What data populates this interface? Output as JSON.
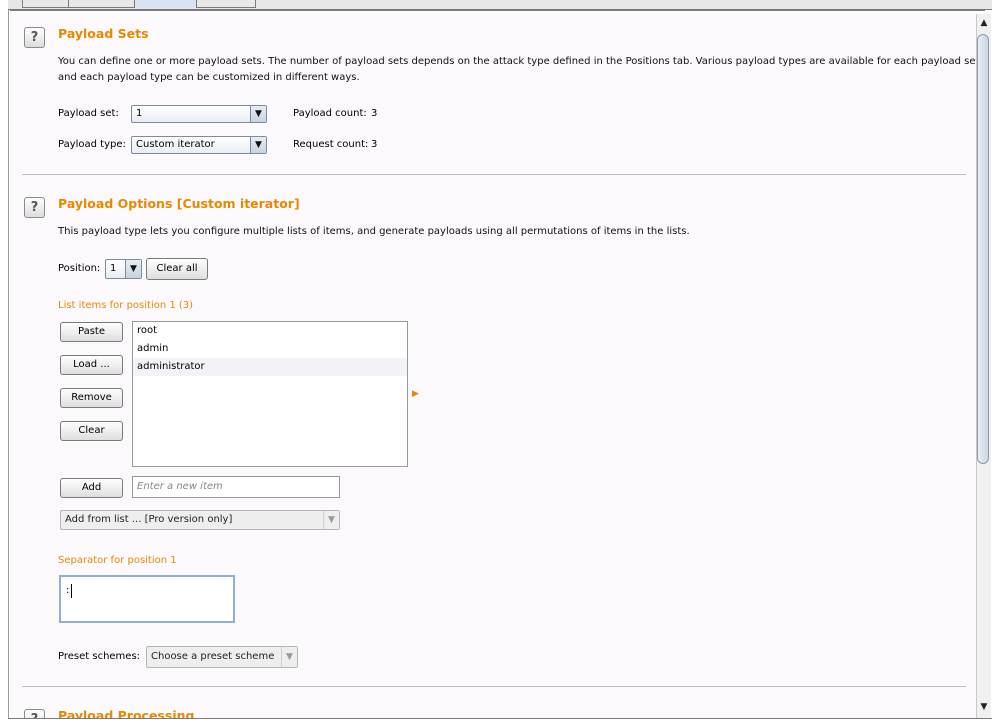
{
  "payload_sets": {
    "title": "Payload Sets",
    "description_line1": "You can define one or more payload sets. The number of payload sets depends on the attack type defined in the Positions tab. Various payload types are available for each payload set,",
    "description_line2": "and each payload type can be customized in different ways.",
    "set_label": "Payload set:",
    "set_value": "1",
    "count_label": "Payload count:",
    "count_value": "3",
    "type_label": "Payload type:",
    "type_value": "Custom iterator",
    "request_label": "Request count:",
    "request_value": "3"
  },
  "payload_options": {
    "title": "Payload Options [Custom iterator]",
    "description": "This payload type lets you configure multiple lists of items, and generate payloads using all permutations of items in the lists.",
    "position_label": "Position:",
    "position_value": "1",
    "clear_all_label": "Clear all",
    "list_label": "List items for position 1 (3)",
    "paste_label": "Paste",
    "load_label": "Load ...",
    "remove_label": "Remove",
    "clear_label": "Clear",
    "items": [
      "root",
      "admin",
      "administrator"
    ],
    "add_label": "Add",
    "add_placeholder": "Enter a new item",
    "add_from_list_label": "Add from list ... [Pro version only]",
    "separator_label": "Separator for position 1",
    "separator_value": ":",
    "preset_label": "Preset schemes:",
    "preset_value": "Choose a preset scheme"
  },
  "payload_processing": {
    "title": "Payload Processing"
  },
  "colors": {
    "accent": "#e58a00",
    "panel_bg": "#fcf9fc"
  },
  "icons": [
    "help-icon",
    "dropdown-arrow-icon",
    "orange-triangle-icon",
    "scroll-up-icon",
    "scroll-down-icon"
  ]
}
